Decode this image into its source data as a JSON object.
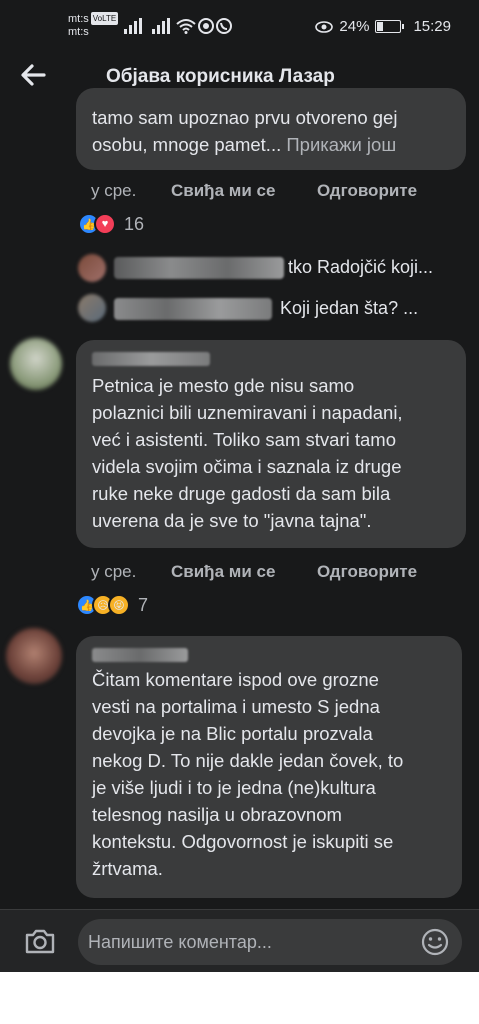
{
  "status_bar": {
    "carrier1": "mt:s",
    "carrier2": "mt:s",
    "volte": "VoLTE",
    "battery": "24%",
    "time": "15:29",
    "battery_level": 0.24
  },
  "header": {
    "title": "Објава корисника Лазар",
    "back_icon": "arrow-left-icon"
  },
  "comments": [
    {
      "lines": [
        "tamo sam upoznao prvu otvoreno gej",
        "osobu, mnoge pamet..."
      ],
      "more": "Прикажи још",
      "time": "у сре.",
      "like": "Свиђа ми се",
      "reply": "Одговорите",
      "reactions": [
        "like",
        "love"
      ],
      "reaction_count": "16",
      "replies": [
        {
          "text": "tko Radojčić koji..."
        },
        {
          "text": "Koji jedan šta? ..."
        }
      ]
    },
    {
      "lines": [
        "Petnica je mesto gde nisu samo",
        "polaznici bili uznemiravani i napadani,",
        "već i asistenti. Toliko sam stvari tamo",
        "videla svojim očima i saznala iz druge",
        "ruke neke druge gadosti da sam bila",
        "uverena da je sve to \"javna tajna\"."
      ],
      "time": "у сре.",
      "like": "Свиђа ми се",
      "reply": "Одговорите",
      "reactions": [
        "like",
        "sad",
        "haha"
      ],
      "reaction_count": "7"
    },
    {
      "lines": [
        "Čitam komentare ispod ove grozne",
        "vesti na portalima i umesto S jedna",
        "devojka je na Blic portalu prozvala",
        "nekog D. To nije dakle jedan čovek, to",
        "je više ljudi i to je jedna (ne)kultura",
        "telesnog nasilja u obrazovnom",
        "kontekstu. Odgovornost je iskupiti se",
        "žrtvama."
      ]
    }
  ],
  "composer": {
    "placeholder": "Напишите коментар...",
    "camera_icon": "camera-icon",
    "emoji_icon": "smile-icon"
  }
}
